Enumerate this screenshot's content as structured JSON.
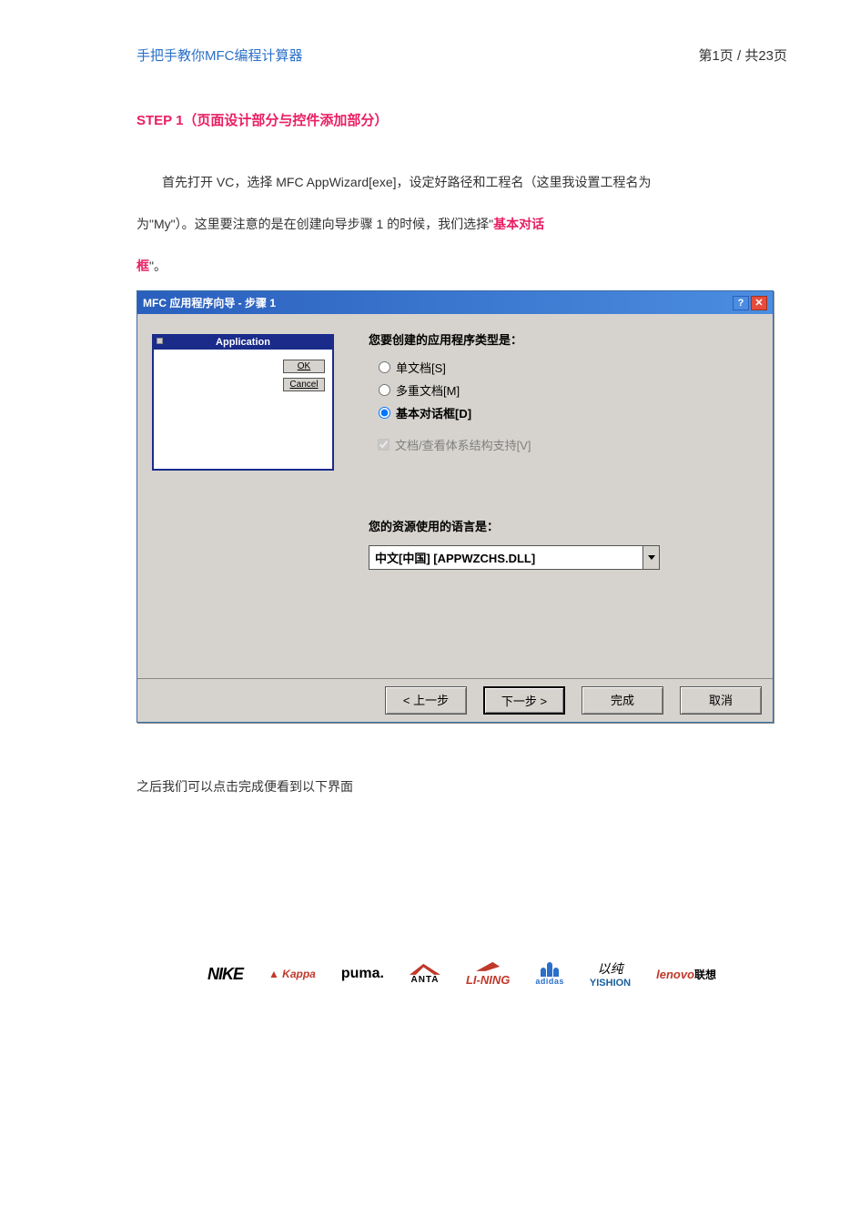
{
  "header": {
    "title": "手把手教你MFC编程计算器",
    "page": "第1页 / 共23页"
  },
  "step_title": "STEP 1（页面设计部分与控件添加部分）",
  "para1_a": "首先打开 VC，选择 MFC AppWizard[exe]，设定好路径和工程名（这里我设置工程名为",
  "para1_b": "为\"My\"）。这里要注意的是在创建向导步骤 1 的时候，我们选择\"",
  "para1_hl1": "基本对话",
  "para1_hl2": "框",
  "para1_c": "\"。",
  "dialog": {
    "title": "MFC 应用程序向导 - 步骤 1",
    "help_btn": "?",
    "close_btn": "✕",
    "preview": {
      "title": "Application",
      "ok": "OK",
      "cancel": "Cancel"
    },
    "q1": "您要创建的应用程序类型是：",
    "radios": {
      "r1": "单文档[S]",
      "r2": "多重文档[M]",
      "r3": "基本对话框[D]"
    },
    "chk": "文档/查看体系结构支持[V]",
    "q2": "您的资源使用的语言是：",
    "lang_value": "中文[中国] [APPWZCHS.DLL]",
    "buttons": {
      "back": "< 上一步",
      "next": "下一步 >",
      "finish": "完成",
      "cancel": "取消"
    }
  },
  "after": "之后我们可以点击完成便看到以下界面",
  "brands": {
    "nike": "NIKE",
    "kappa": "▲ Kappa",
    "puma": "puma.",
    "anta": "ANTA",
    "lining": "LI-NING",
    "adidas": "adidas",
    "yishion_top": "以纯",
    "yishion": "YISHION",
    "lenovo_en": "lenovo",
    "lenovo_cn": "联想"
  }
}
